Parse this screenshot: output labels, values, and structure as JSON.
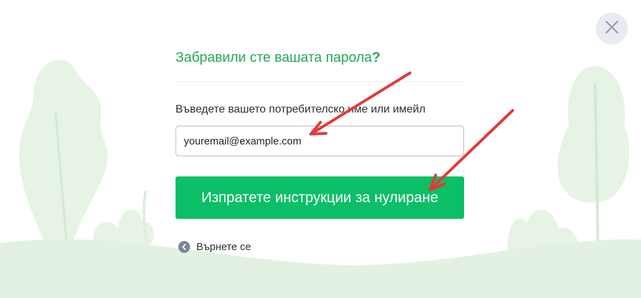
{
  "dialog": {
    "title_text": "Забравили сте вашата парола",
    "title_mark": "?",
    "field_label": "Въведете вашето потребителско име или имейл",
    "email_value": "youremail@example.com",
    "submit_label": "Изпратете инструкции за нулиране",
    "back_label": "Върнете се"
  },
  "icons": {
    "close": "close-icon",
    "back": "chevron-left-icon"
  },
  "colors": {
    "accent_green": "#0bbf67",
    "title_green": "#22a85a",
    "annotation_red": "#e03a3a",
    "background_art": "#e3f1e2"
  }
}
